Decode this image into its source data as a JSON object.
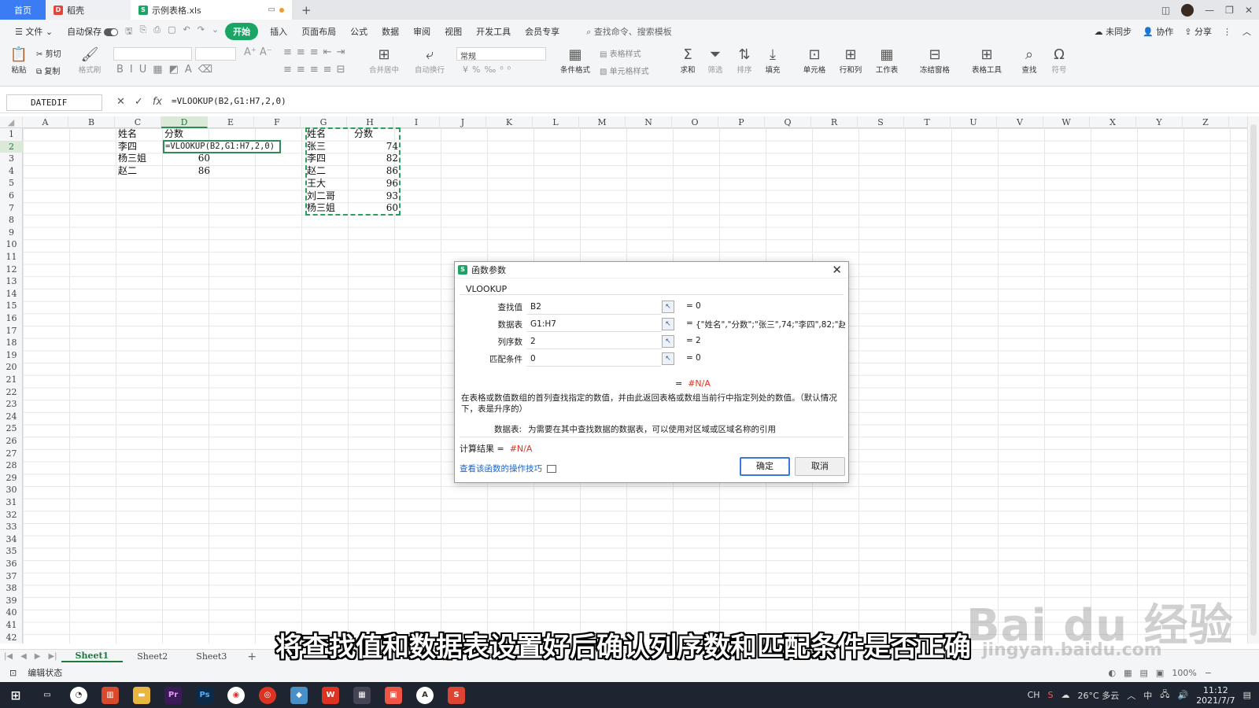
{
  "tabs": {
    "home": "首页",
    "docer": "稻壳",
    "file": "示例表格.xls",
    "new": "+"
  },
  "menu": {
    "file": "文件",
    "autosave": "自动保存",
    "start": "开始",
    "items": [
      "插入",
      "页面布局",
      "公式",
      "数据",
      "审阅",
      "视图",
      "开发工具",
      "会员专享"
    ],
    "search": "查找命令、搜索模板",
    "sync": "未同步",
    "collab": "协作",
    "share": "分享"
  },
  "ribbon": {
    "paste": "粘贴",
    "cut": "剪切",
    "copy": "复制",
    "format_painter": "格式刷",
    "merge": "合并居中",
    "wrap": "自动换行",
    "number_format": "常规",
    "cond_format": "条件格式",
    "table_style": "表格样式",
    "cell_style": "单元格样式",
    "sum": "求和",
    "filter": "筛选",
    "sort": "排序",
    "fill": "填充",
    "cell": "单元格",
    "rowcol": "行和列",
    "sheet": "工作表",
    "freeze": "冻结窗格",
    "table_tools": "表格工具",
    "find": "查找",
    "symbol": "符号"
  },
  "formula_bar": {
    "name_box": "DATEDIF",
    "formula": "=VLOOKUP(B2,G1:H7,2,0)"
  },
  "columns": [
    "A",
    "B",
    "C",
    "D",
    "E",
    "F",
    "G",
    "H",
    "I",
    "J",
    "K",
    "L",
    "M",
    "N",
    "O",
    "P",
    "Q",
    "R",
    "S",
    "T",
    "U",
    "V",
    "W",
    "X",
    "Y",
    "Z"
  ],
  "rows_count": 42,
  "left_table": {
    "headers": [
      "姓名",
      "分数"
    ],
    "rows": [
      {
        "name": "李四",
        "score": ""
      },
      {
        "name": "杨三姐",
        "score": "60"
      },
      {
        "name": "赵二",
        "score": "86"
      }
    ],
    "editing_formula": "=VLOOKUP(B2,G1:H7,2,0)"
  },
  "right_table": {
    "headers": [
      "姓名",
      "分数"
    ],
    "rows": [
      {
        "name": "张三",
        "score": "74"
      },
      {
        "name": "李四",
        "score": "82"
      },
      {
        "name": "赵二",
        "score": "86"
      },
      {
        "name": "王大",
        "score": "96"
      },
      {
        "name": "刘二哥",
        "score": "93"
      },
      {
        "name": "杨三姐",
        "score": "60"
      }
    ]
  },
  "dialog": {
    "title": "函数参数",
    "function": "VLOOKUP",
    "args": [
      {
        "label": "查找值",
        "value": "B2",
        "result": "0"
      },
      {
        "label": "数据表",
        "value": "G1:H7",
        "result": "{\"姓名\",\"分数\";\"张三\",74;\"李四\",82;\"赵二\"..."
      },
      {
        "label": "列序数",
        "value": "2",
        "result": "2"
      },
      {
        "label": "匹配条件",
        "value": "0",
        "result": "0"
      }
    ],
    "eq": "=",
    "result_top": "#N/A",
    "description": "在表格或数值数组的首列查找指定的数值，并由此返回表格或数组当前行中指定列处的数值。（默认情况下，表是升序的）",
    "arg_desc_key": "数据表:",
    "arg_desc_text": "为需要在其中查找数据的数据表，可以使用对区域或区域名称的引用",
    "calc_label": "计算结果 =",
    "calc_value": "#N/A",
    "help_link": "查看该函数的操作技巧",
    "ok": "确定",
    "cancel": "取消"
  },
  "sheets": [
    "Sheet1",
    "Sheet2",
    "Sheet3"
  ],
  "status": {
    "mode": "编辑状态",
    "zoom": "100%"
  },
  "taskbar": {
    "lang": "中",
    "weather": "26°C 多云",
    "time": "11:12",
    "date": "2021/7/7"
  },
  "subtitle": "将查找值和数据表设置好后确认列序数和匹配条件是否正确",
  "watermark": {
    "main": "Bai du 经验",
    "url": "jingyan.baidu.com"
  },
  "colors": {
    "accent_green": "#1aa565",
    "home_blue": "#3b7cf5",
    "error_red": "#dd3322"
  }
}
